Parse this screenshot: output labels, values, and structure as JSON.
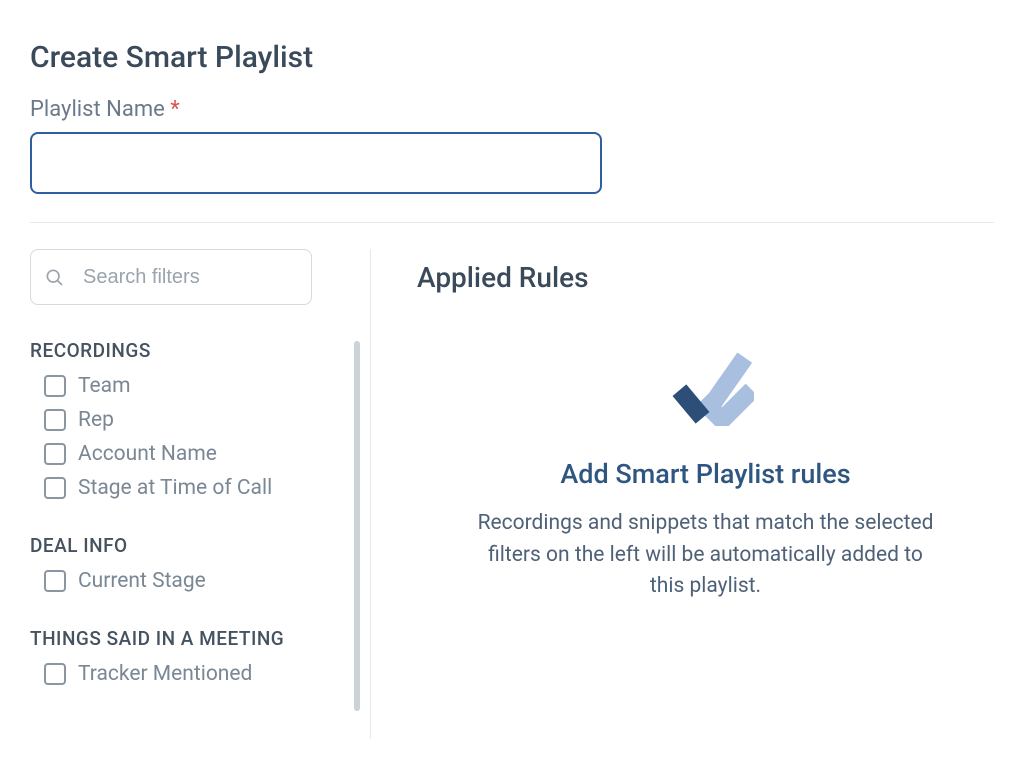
{
  "header": {
    "title": "Create Smart Playlist",
    "name_label": "Playlist Name",
    "required_mark": "*"
  },
  "sidebar": {
    "search_placeholder": "Search filters",
    "groups": [
      {
        "heading": "RECORDINGS",
        "items": [
          {
            "label": "Team"
          },
          {
            "label": "Rep"
          },
          {
            "label": "Account Name"
          },
          {
            "label": "Stage at Time of Call"
          }
        ]
      },
      {
        "heading": "DEAL INFO",
        "items": [
          {
            "label": "Current Stage"
          }
        ]
      },
      {
        "heading": "THINGS SAID IN A MEETING",
        "items": [
          {
            "label": "Tracker Mentioned"
          }
        ]
      }
    ]
  },
  "main": {
    "applied_rules_title": "Applied Rules",
    "empty_title": "Add Smart Playlist rules",
    "empty_desc": "Recordings and snippets that match the selected filters on the left will be automatically added to this playlist."
  },
  "colors": {
    "primary_border": "#2f5fa0",
    "check_dark": "#2e4e7a",
    "check_light": "#a9bfe0"
  }
}
